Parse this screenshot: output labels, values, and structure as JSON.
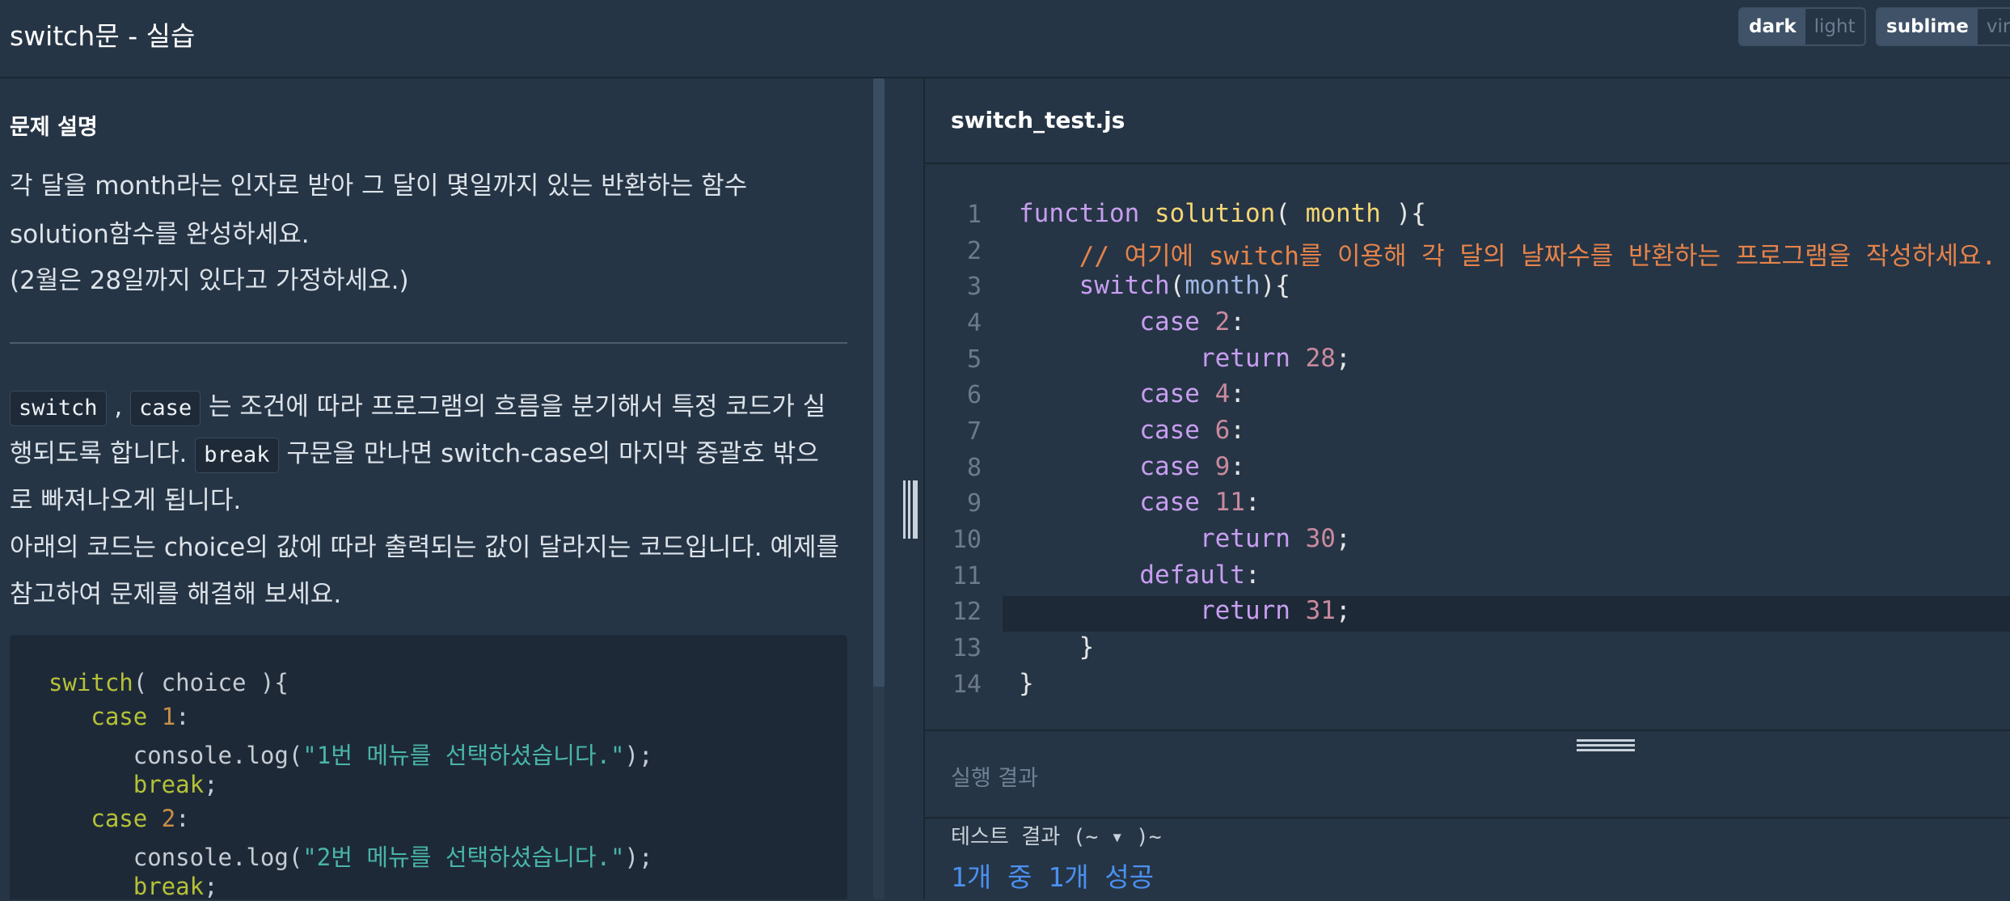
{
  "header": {
    "title": "switch문 - 실습",
    "theme": {
      "active": "dark",
      "inactive": "light"
    },
    "editor_mode": {
      "active": "sublime",
      "inactive": "vim"
    }
  },
  "description": {
    "heading": "문제 설명",
    "lines": [
      "각 달을 month라는 인자로 받아 그 달이 몇일까지 있는 반환하는 함수",
      "solution함수를 완성하세요.",
      "(2월은 28일까지 있다고 가정하세요.)"
    ],
    "chip_switch": "switch",
    "comma": ",",
    "chip_case": "case",
    "t1_rest": "는 조건에 따라 프로그램의 흐름을 분기해서 특정 코드가 실",
    "t2_pre": "행되도록 합니다.",
    "chip_break": "break",
    "t2_rest": "구문을 만나면 switch-case의 마지막 중괄호 밖으",
    "t3": "로 빠져나오게 됩니다.",
    "t4": "아래의 코드는 choice의 값에 따라 출력되는 값이 달라지는 코드입니다. 예제를",
    "t5": "참고하여 문제를 해결해 보세요."
  },
  "example_code": {
    "l1_kw": "switch",
    "l1_rest": "( choice ){",
    "l2_kw": "case",
    "l2_num": "1",
    "l2_rest": ":",
    "l3_pre": "console.log(",
    "l3_str": "\"1번 메뉴를 선택하셨습니다.\"",
    "l3_post": ");",
    "l4_kw": "break",
    "l4_rest": ";",
    "l5_kw": "case",
    "l5_num": "2",
    "l5_rest": ":",
    "l6_pre": "console.log(",
    "l6_str": "\"2번 메뉴를 선택하셨습니다.\"",
    "l6_post": ");",
    "l7_kw": "break",
    "l7_rest": ";"
  },
  "editor": {
    "filename": "switch_test.js",
    "line_numbers": [
      "1",
      "2",
      "3",
      "4",
      "5",
      "6",
      "7",
      "8",
      "9",
      "10",
      "11",
      "12",
      "13",
      "14"
    ],
    "c1_kw": "function",
    "c1_fn": "solution",
    "c1_a": "(",
    "c1_pa": "month",
    "c1_b": "){",
    "c2_cm": "// 여기에 switch를 이용해 각 달의 날짜수를 반환하는 프로그램을 작성하세요.",
    "c3_kw": "switch",
    "c3_a": "(",
    "c3_vr": "month",
    "c3_b": "){",
    "c4_kw": "case",
    "c4_nm": "2",
    "c4_b": ":",
    "c5_kw": "return",
    "c5_nm": "28",
    "c5_b": ";",
    "c6_kw": "case",
    "c6_nm": "4",
    "c6_b": ":",
    "c7_kw": "case",
    "c7_nm": "6",
    "c7_b": ":",
    "c8_kw": "case",
    "c8_nm": "9",
    "c8_b": ":",
    "c9_kw": "case",
    "c9_nm": "11",
    "c9_b": ":",
    "c10_kw": "return",
    "c10_nm": "30",
    "c10_b": ";",
    "c11_kw": "default",
    "c11_b": ":",
    "c12_kw": "return",
    "c12_nm": "31",
    "c12_b": ";",
    "c13": "}",
    "c14": "}"
  },
  "result": {
    "title": "실행 결과",
    "test_line": "테스트 결과 (~ ▾ )~",
    "summary": "1개 중 1개 성공"
  }
}
